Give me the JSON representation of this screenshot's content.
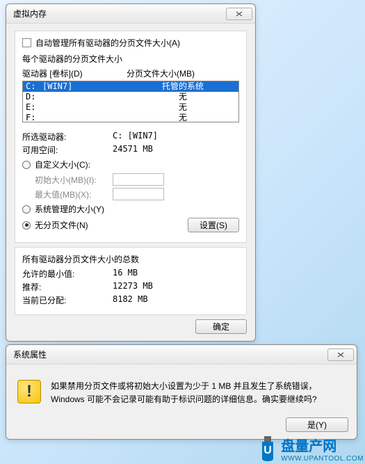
{
  "main": {
    "title": "虚拟内存",
    "auto_manage": "自动管理所有驱动器的分页文件大小(A)",
    "per_drive": "每个驱动器的分页文件大小",
    "header_drive": "驱动器 [卷标](D)",
    "header_paging": "分页文件大小(MB)",
    "drives": [
      {
        "letter": "C:",
        "label": "[WIN7]",
        "value": "托管的系统",
        "sel": true
      },
      {
        "letter": "D:",
        "label": "",
        "value": "无",
        "sel": false
      },
      {
        "letter": "E:",
        "label": "",
        "value": "无",
        "sel": false
      },
      {
        "letter": "F:",
        "label": "",
        "value": "无",
        "sel": false
      }
    ],
    "sel_drive_label": "所选驱动器:",
    "sel_drive_value": "C:  [WIN7]",
    "free_space_label": "可用空间:",
    "free_space_value": "24571 MB",
    "custom_size": "自定义大小(C):",
    "initial_size": "初始大小(MB)(I):",
    "max_size": "最大值(MB)(X):",
    "system_managed": "系统管理的大小(Y)",
    "no_paging": "无分页文件(N)",
    "set_button": "设置(S)",
    "totals_legend": "所有驱动器分页文件大小的总数",
    "min_allowed_label": "允许的最小值:",
    "min_allowed_value": "16 MB",
    "recommended_label": "推荐:",
    "recommended_value": "12273 MB",
    "allocated_label": "当前已分配:",
    "allocated_value": "8182 MB",
    "ok_button": "确定"
  },
  "dialog": {
    "title": "系统属性",
    "message": "如果禁用分页文件或将初始大小设置为少于 1 MB 并且发生了系统错误，Windows 可能不会记录可能有助于标识问题的详细信息。确实要继续吗?",
    "yes_button": "是(Y)"
  },
  "watermark": {
    "brand": "盘量产网",
    "url": "WWW.UPANTOOL.COM"
  }
}
